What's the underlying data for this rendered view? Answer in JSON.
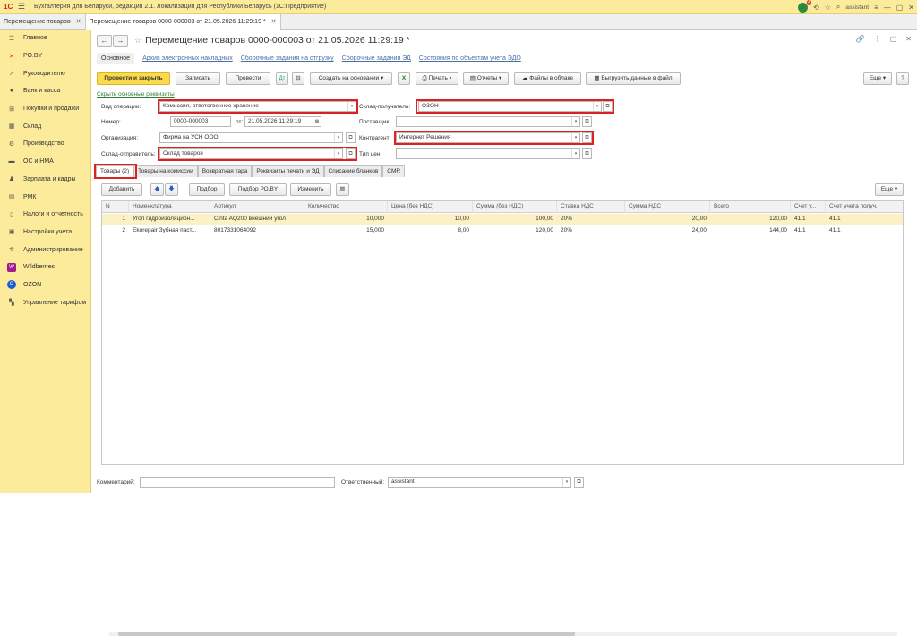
{
  "titlebar": {
    "logo": "1С",
    "title": "Бухгалтерия для Беларуси, редакция 2.1. Локализация для Республики Беларусь   (1С:Предприятие)",
    "notif_count": "4",
    "user": "assistant"
  },
  "tabs": [
    {
      "label": "Перемещение товаров"
    },
    {
      "label": "Перемещение товаров 0000-000003 от 21.05.2026 11:29:19 *"
    }
  ],
  "sidebar": {
    "items": [
      {
        "label": "Главное",
        "icon": "menu-lines-icon"
      },
      {
        "label": "РО.BY",
        "icon": "ro-icon"
      },
      {
        "label": "Руководителю",
        "icon": "chart-line-icon"
      },
      {
        "label": "Банк и касса",
        "icon": "coin-icon"
      },
      {
        "label": "Покупки и продажи",
        "icon": "cart-icon"
      },
      {
        "label": "Склад",
        "icon": "warehouse-icon"
      },
      {
        "label": "Производство",
        "icon": "gear-factory-icon"
      },
      {
        "label": "ОС и НМА",
        "icon": "truck-icon"
      },
      {
        "label": "Зарплата и кадры",
        "icon": "people-icon"
      },
      {
        "label": "РМК",
        "icon": "register-icon"
      },
      {
        "label": "Налоги и отчетность",
        "icon": "document-icon"
      },
      {
        "label": "Настройки учета",
        "icon": "settings-icon"
      },
      {
        "label": "Администрирование",
        "icon": "gear-icon"
      },
      {
        "label": "Wildberries",
        "icon": "wildberries-icon"
      },
      {
        "label": "OZON",
        "icon": "ozon-icon"
      },
      {
        "label": "Управление тарифом",
        "icon": "tariff-icon"
      }
    ]
  },
  "document": {
    "title": "Перемещение товаров 0000-000003 от 21.05.2026 11:29:19 *",
    "links": [
      "Основное",
      "Архив электронных накладных",
      "Сборочные задания на отгрузку",
      "Сборочные задания ЭД",
      "Состояния по объектам учета ЭДО"
    ],
    "commands": {
      "post_close": "Провести и закрыть",
      "save": "Записать",
      "post": "Провести",
      "create_based": "Создать на основании",
      "print": "Печать",
      "reports": "Отчеты",
      "cloud": "Файлы в облаке",
      "upload": "Выгрузить данные в файл",
      "more": "Еще",
      "help": "?"
    },
    "hide_details": "Скрыть основные реквизиты",
    "fields": {
      "op_type_label": "Вид операции:",
      "op_type_value": "Комиссия, ответственное хранение",
      "number_label": "Номер:",
      "number_value": "0000-000003",
      "date_label": "от:",
      "date_value": "21.05.2026 11:29:19",
      "org_label": "Организация:",
      "org_value": "Фирма на УСН ООО",
      "sender_label": "Склад-отправитель:",
      "sender_value": "Склад товаров",
      "receiver_label": "Склад-получатель:",
      "receiver_value": "ОЗОН",
      "supplier_label": "Поставщик:",
      "supplier_value": "",
      "counterparty_label": "Контрагент:",
      "counterparty_value": "Интернет Решения",
      "price_type_label": "Тип цен:",
      "price_type_value": ""
    },
    "inner_tabs": [
      "Товары (2)",
      "Товары на комиссии",
      "Возвратная тара",
      "Реквизиты печати и ЭД",
      "Списание бланков",
      "CMR"
    ],
    "table_commands": {
      "add": "Добавить",
      "pick": "Подбор",
      "pick_ro": "Подбор РО.BY",
      "change": "Изменить",
      "more": "Еще"
    },
    "columns": [
      "N",
      "Номенклатура",
      "Артикул",
      "Количество",
      "Цена (без НДС)",
      "Сумма (без НДС)",
      "Ставка НДС",
      "Сумма НДС",
      "Всего",
      "Счет у...",
      "Счет учета получ."
    ],
    "rows": [
      [
        "1",
        "Угол гидроизоляцион...",
        "Cinta AQ200 внешний угол",
        "10,000",
        "10,00",
        "100,00",
        "20%",
        "20,00",
        "120,00",
        "41.1",
        "41.1"
      ],
      [
        "2",
        "Ekorepair Зубная паст...",
        "8017331064092",
        "15,000",
        "8,00",
        "120,00",
        "20%",
        "24,00",
        "144,00",
        "41.1",
        "41.1"
      ]
    ],
    "footer": {
      "comment_label": "Комментарий:",
      "comment_value": "",
      "responsible_label": "Ответственный:",
      "responsible_value": "assistant"
    }
  }
}
